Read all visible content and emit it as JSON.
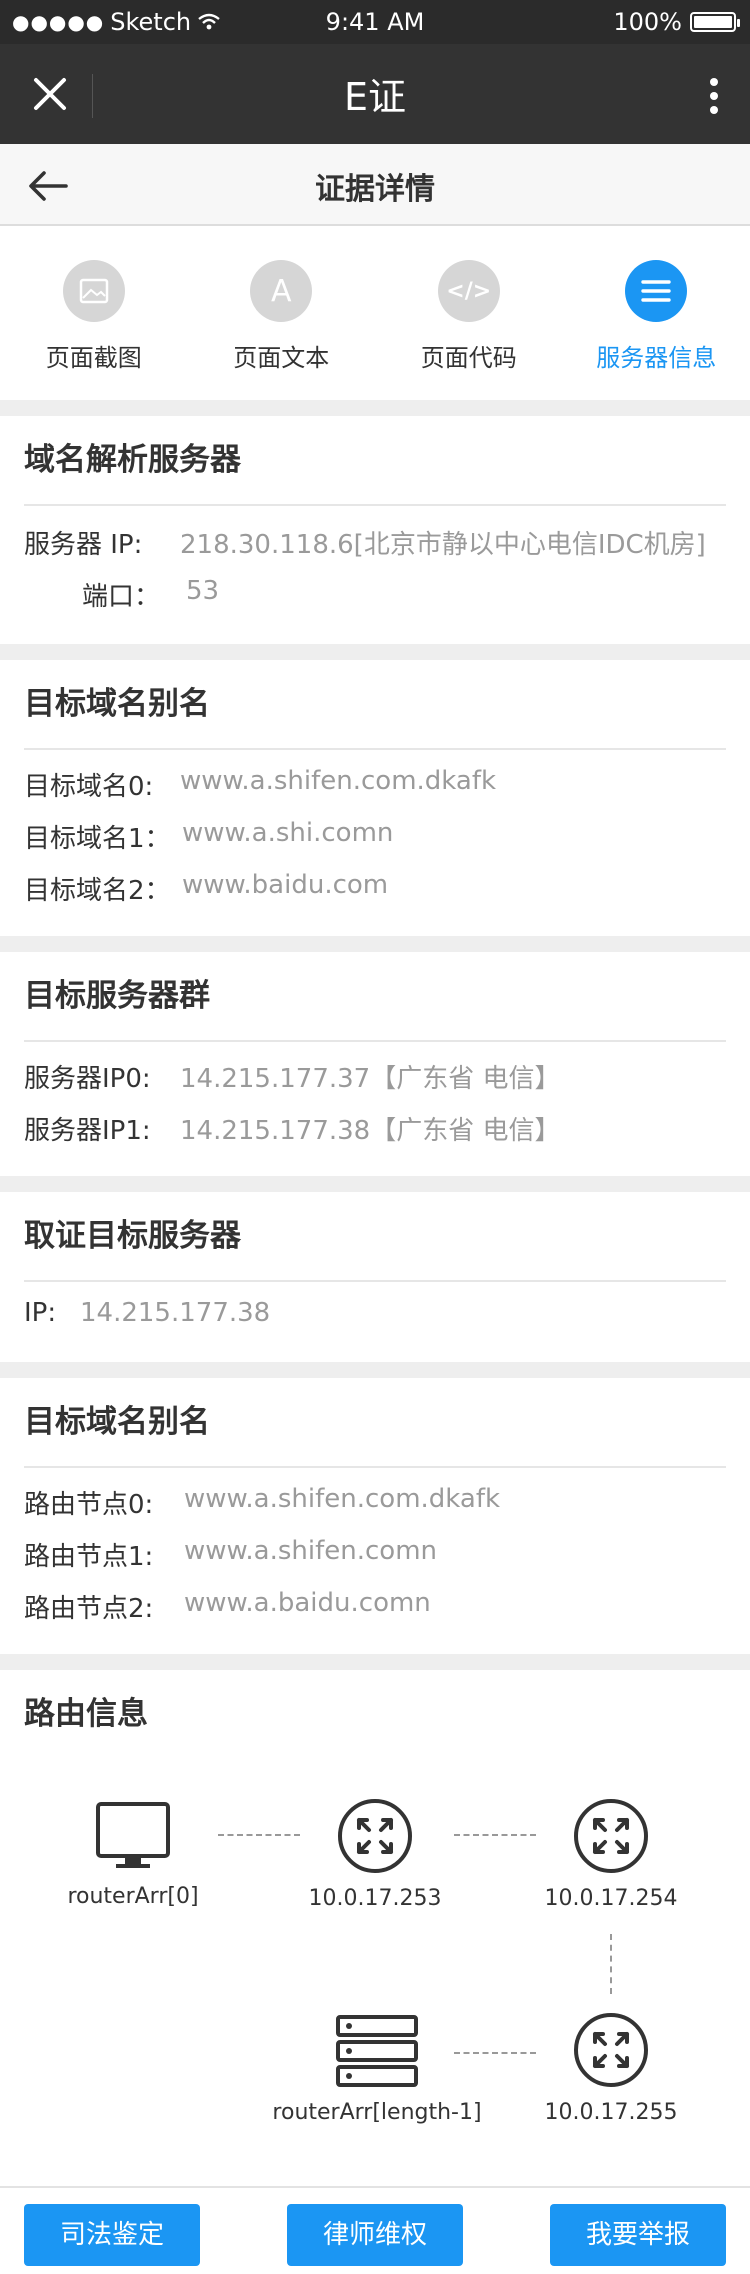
{
  "statusbar": {
    "dots": "●●●●●",
    "carrier": "Sketch",
    "time": "9:41 AM",
    "battery": "100%",
    "battery_level": 1.0
  },
  "appbar": {
    "title": "E证"
  },
  "navbar": {
    "title": "证据详情"
  },
  "tabs": [
    {
      "label": "页面截图",
      "icon": "image-icon",
      "active": false
    },
    {
      "label": "页面文本",
      "icon": "text-a-icon",
      "glyph": "A",
      "active": false
    },
    {
      "label": "页面代码",
      "icon": "code-icon",
      "glyph": "</>",
      "active": false
    },
    {
      "label": "服务器信息",
      "icon": "list-icon",
      "active": true
    }
  ],
  "dns_server": {
    "title": "域名解析服务器",
    "rows": [
      {
        "key": "服务器 IP:",
        "value": "218.30.118.6[北京市静以中心电信IDC机房]"
      },
      {
        "key": "端口：",
        "value": "53"
      }
    ]
  },
  "alias": {
    "title": "目标域名别名",
    "rows": [
      {
        "key": "目标域名0:",
        "value": "www.a.shifen.com.dkafk"
      },
      {
        "key": "目标域名1：",
        "value": "www.a.shi.comn"
      },
      {
        "key": "目标域名2：",
        "value": "www.baidu.com"
      }
    ]
  },
  "server_group": {
    "title": "目标服务器群",
    "rows": [
      {
        "key": "服务器IP0:",
        "value": "14.215.177.37【广东省 电信】"
      },
      {
        "key": "服务器IP1:",
        "value": "14.215.177.38【广东省 电信】"
      }
    ]
  },
  "target_server": {
    "title": "取证目标服务器",
    "rows": [
      {
        "key": "IP:",
        "value": "14.215.177.38"
      }
    ]
  },
  "alias2": {
    "title": "目标域名别名",
    "rows": [
      {
        "key": "路由节点0:",
        "value": "www.a.shifen.com.dkafk"
      },
      {
        "key": "路由节点1:",
        "value": "www.a.shifen.comn"
      },
      {
        "key": "路由节点2:",
        "value": "www.a.baidu.comn"
      }
    ]
  },
  "route": {
    "title": "路由信息",
    "nodes": [
      {
        "label": "routerArr[0]",
        "icon": "monitor-icon"
      },
      {
        "label": "10.0.17.253",
        "icon": "router-icon"
      },
      {
        "label": "10.0.17.254",
        "icon": "router-icon"
      },
      {
        "label": "10.0.17.255",
        "icon": "router-icon"
      },
      {
        "label": "routerArr[length-1]",
        "icon": "server-stack-icon"
      }
    ]
  },
  "footer": {
    "btn1": "司法鉴定",
    "btn2": "律师维权",
    "btn3": "我要举报"
  },
  "colors": {
    "accent": "#1b96f3",
    "dark": "#333333"
  }
}
